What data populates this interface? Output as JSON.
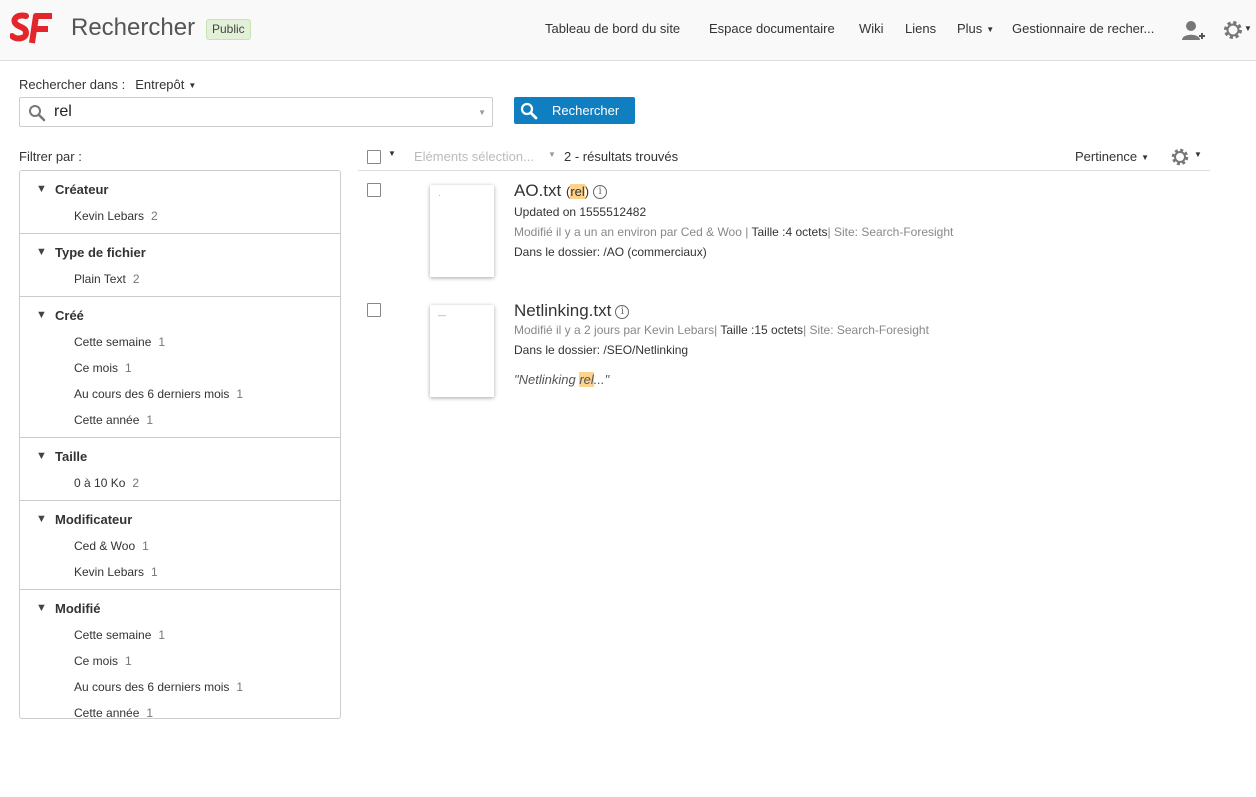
{
  "header": {
    "title": "Rechercher",
    "badge": "Public",
    "nav": {
      "dashboard": "Tableau de bord du site",
      "doclib": "Espace documentaire",
      "wiki": "Wiki",
      "links": "Liens",
      "more": "Plus",
      "manager": "Gestionnaire de recher..."
    }
  },
  "search": {
    "scope_label": "Rechercher dans :",
    "scope_value": "Entrepôt",
    "query": "rel",
    "button": "Rechercher"
  },
  "facets_label": "Filtrer par :",
  "facets": [
    {
      "name": "Créateur",
      "items": [
        {
          "label": "Kevin Lebars",
          "count": "2"
        }
      ]
    },
    {
      "name": "Type de fichier",
      "items": [
        {
          "label": "Plain Text",
          "count": "2"
        }
      ]
    },
    {
      "name": "Créé",
      "items": [
        {
          "label": "Cette semaine",
          "count": "1"
        },
        {
          "label": "Ce mois",
          "count": "1"
        },
        {
          "label": "Au cours des 6 derniers mois",
          "count": "1"
        },
        {
          "label": "Cette année",
          "count": "1"
        }
      ]
    },
    {
      "name": "Taille",
      "items": [
        {
          "label": "0 à 10 Ko",
          "count": "2"
        }
      ]
    },
    {
      "name": "Modificateur",
      "items": [
        {
          "label": "Ced & Woo",
          "count": "1"
        },
        {
          "label": "Kevin Lebars",
          "count": "1"
        }
      ]
    },
    {
      "name": "Modifié",
      "items": [
        {
          "label": "Cette semaine",
          "count": "1"
        },
        {
          "label": "Ce mois",
          "count": "1"
        },
        {
          "label": "Au cours des 6 derniers mois",
          "count": "1"
        },
        {
          "label": "Cette année",
          "count": "1"
        }
      ]
    }
  ],
  "toolbar": {
    "selected_items": "Eléments sélection...",
    "result_count": "2 - résultats trouvés",
    "sort": "Pertinence"
  },
  "results": [
    {
      "name": "AO.txt",
      "title_hit": "rel",
      "updated": "Updated on 1555512482",
      "modified": "Modifié il y a un an environ par Ced & Woo |",
      "size": "Taille :4 octets",
      "site": "| Site: Search-Foresight",
      "folder": "Dans le dossier: /AO (commerciaux)"
    },
    {
      "name": "Netlinking.txt",
      "modified": "Modifié il y a 2 jours par Kevin Lebars|",
      "size": "Taille :15 octets",
      "site": "| Site: Search-Foresight",
      "folder": "Dans le dossier: /SEO/Netlinking",
      "snippet_pre": "\"Netlinking ",
      "snippet_hit": "rel",
      "snippet_post": "...\""
    }
  ],
  "colors": {
    "brand_red": "#e3262a",
    "button_blue": "#0f7fc1",
    "highlight": "#fcd28d",
    "badge_green": "#e1f0d6"
  }
}
